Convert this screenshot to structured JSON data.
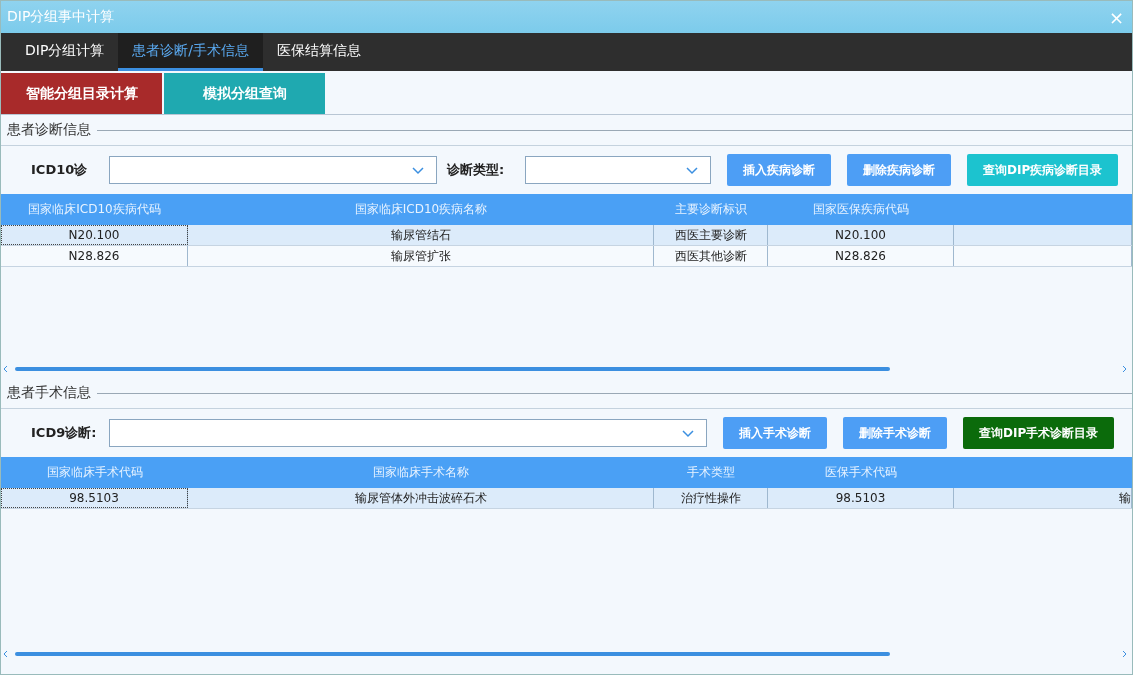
{
  "window": {
    "title": "DIP分组事中计算",
    "close": "×"
  },
  "tabs": [
    {
      "label": "DIP分组计算",
      "selected": false
    },
    {
      "label": "患者诊断/手术信息",
      "selected": true
    },
    {
      "label": "医保结算信息",
      "selected": false
    }
  ],
  "actions": [
    {
      "label": "智能分组目录计算",
      "color": "#a82a2a"
    },
    {
      "label": "模拟分组查询",
      "color": "#1fa9b0"
    }
  ],
  "sections": [
    {
      "title": "患者诊断信息",
      "field_label": "ICD10诊",
      "type_label": "诊断类型:",
      "buttons": [
        {
          "label": "插入疾病诊断",
          "color": "#4d9ef5"
        },
        {
          "label": "删除疾病诊断",
          "color": "#4d9ef5"
        },
        {
          "label": "查询DIP疾病诊断目录",
          "color": "#1cc3cf"
        }
      ],
      "columns": [
        "国家临床ICD10疾病代码",
        "国家临床ICD10疾病名称",
        "主要诊断标识",
        "国家医保疾病代码"
      ],
      "rows": [
        {
          "selected": true,
          "cells": [
            "N20.100",
            "输尿管结石",
            "西医主要诊断",
            "N20.100",
            ""
          ]
        },
        {
          "selected": false,
          "cells": [
            "N28.826",
            "输尿管扩张",
            "西医其他诊断",
            "N28.826",
            ""
          ]
        }
      ]
    },
    {
      "title": "患者手术信息",
      "field_label": "ICD9诊断:",
      "buttons": [
        {
          "label": "插入手术诊断",
          "color": "#4d9ef5"
        },
        {
          "label": "删除手术诊断",
          "color": "#4d9ef5"
        },
        {
          "label": "查询DIP手术诊断目录",
          "color": "#0b6b0b"
        }
      ],
      "columns": [
        "国家临床手术代码",
        "国家临床手术名称",
        "手术类型",
        "医保手术代码"
      ],
      "rows": [
        {
          "selected": true,
          "cells": [
            "98.5103",
            "输尿管体外冲击波碎石术",
            "治疗性操作",
            "98.5103",
            "输"
          ]
        }
      ]
    }
  ]
}
